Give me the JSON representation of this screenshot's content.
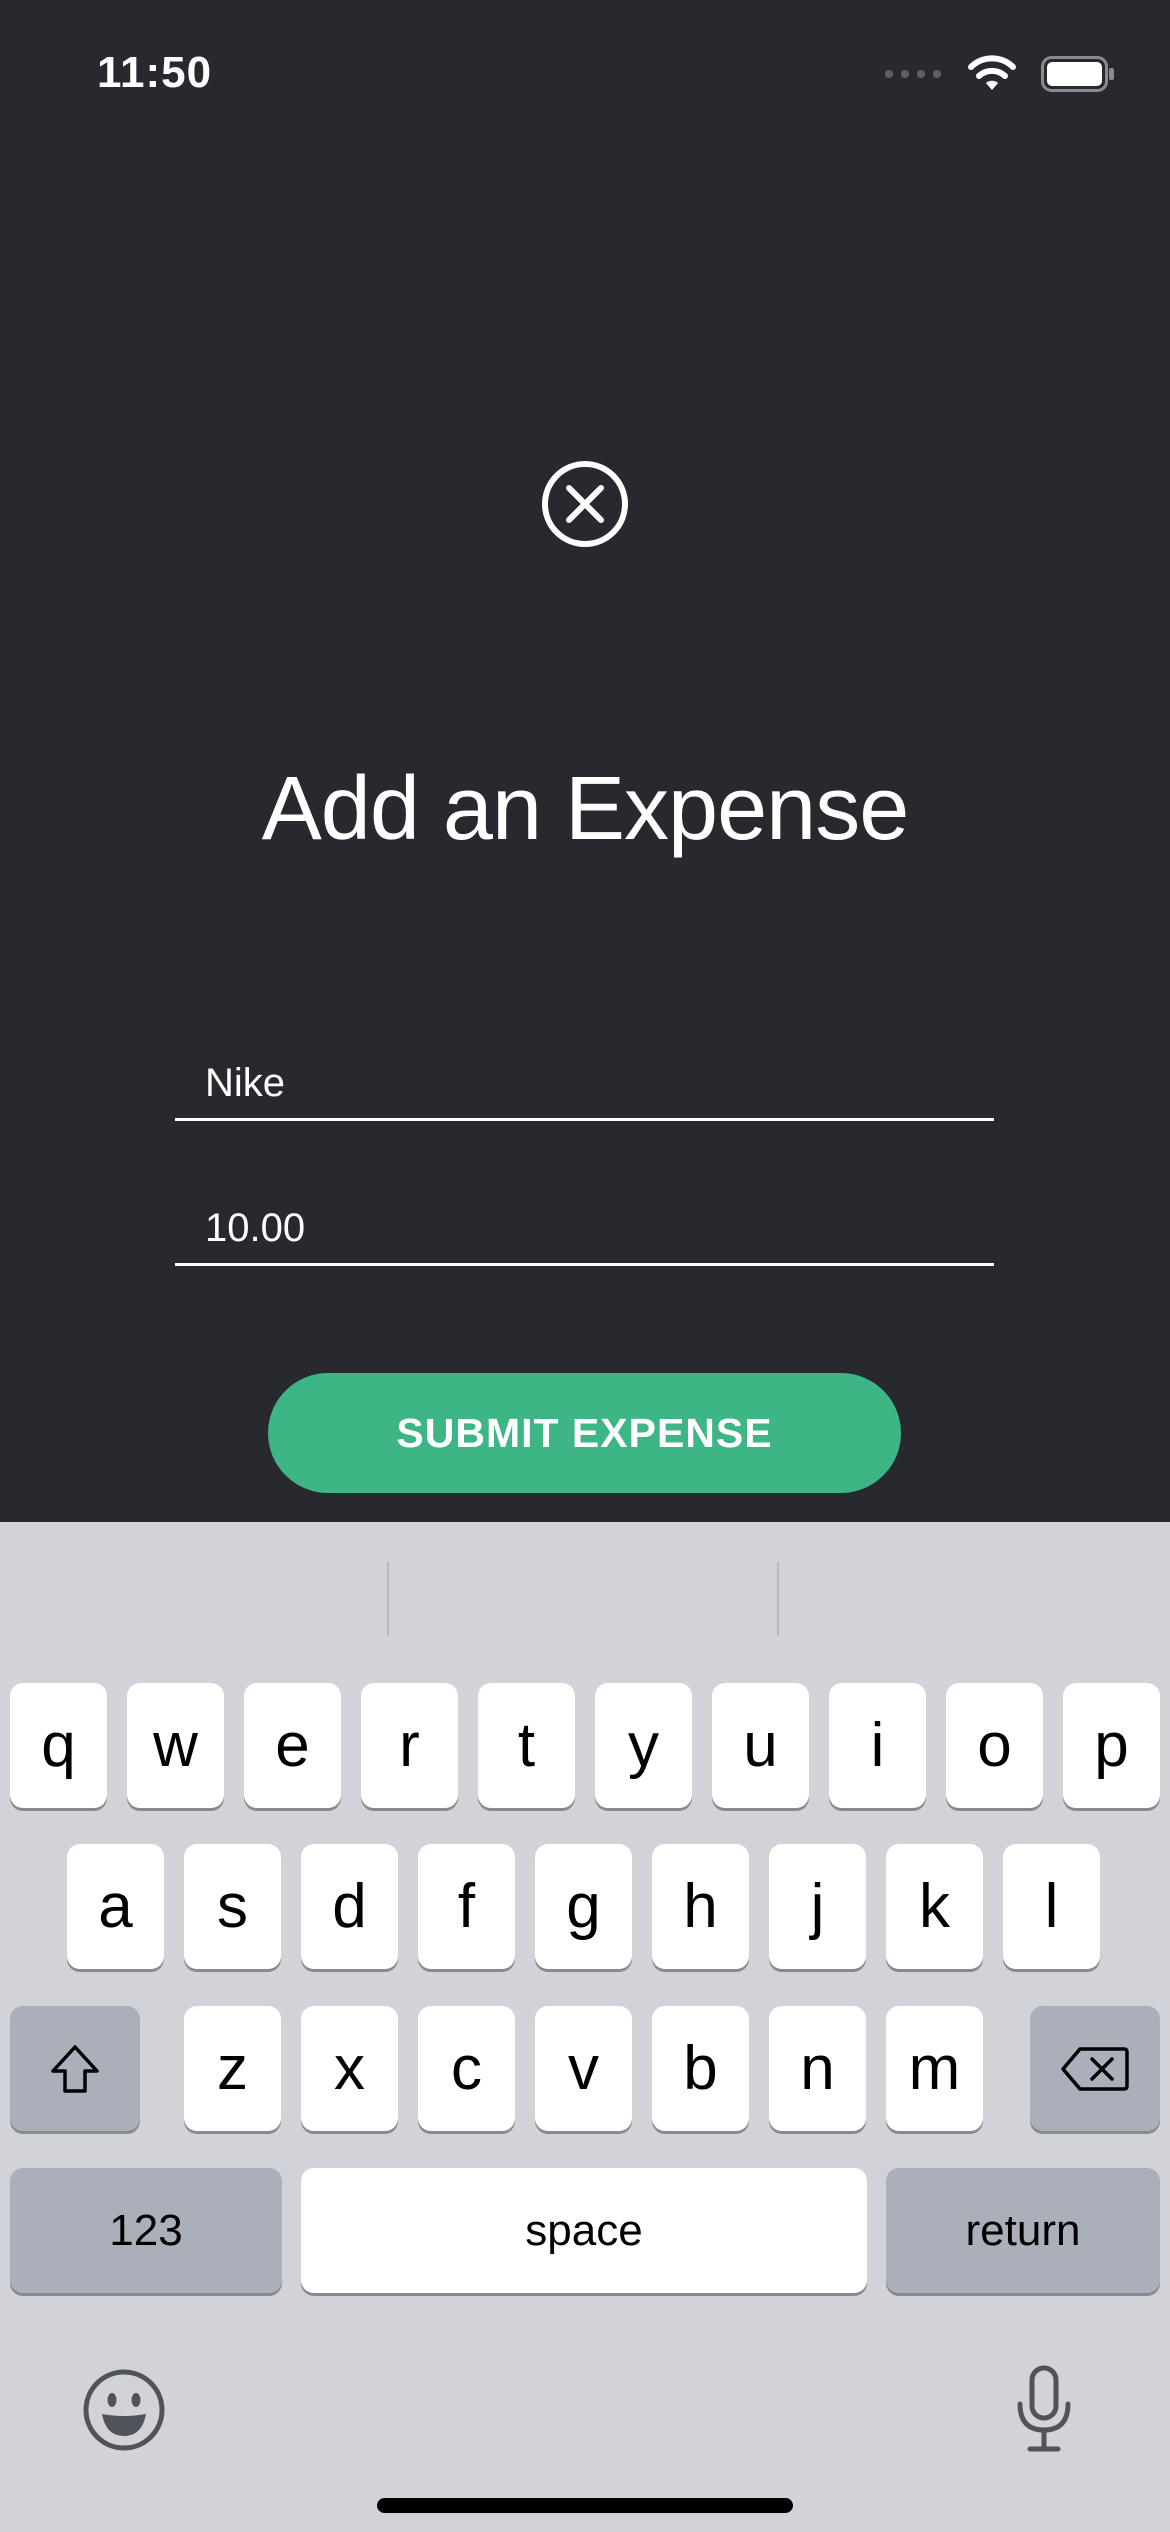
{
  "status_bar": {
    "time": "11:50",
    "icons": [
      "cellular-signal-icon",
      "wifi-icon",
      "battery-icon"
    ]
  },
  "form": {
    "close_icon": "close-circle-icon",
    "title": "Add an Expense",
    "name_value": "Nike",
    "amount_value": "10.00",
    "submit_label": "SUBMIT EXPENSE"
  },
  "keyboard": {
    "rows": [
      [
        "q",
        "w",
        "e",
        "r",
        "t",
        "y",
        "u",
        "i",
        "o",
        "p"
      ],
      [
        "a",
        "s",
        "d",
        "f",
        "g",
        "h",
        "j",
        "k",
        "l"
      ],
      [
        "z",
        "x",
        "c",
        "v",
        "b",
        "n",
        "m"
      ]
    ],
    "shift_icon": "shift-icon",
    "delete_icon": "backspace-icon",
    "numbers_label": "123",
    "space_label": "space",
    "return_label": "return",
    "emoji_icon": "emoji-icon",
    "dictation_icon": "microphone-icon"
  },
  "colors": {
    "background": "#28292e",
    "accent": "#3db585",
    "keyboard_background": "#d1d3d9",
    "special_key": "#abafba"
  }
}
